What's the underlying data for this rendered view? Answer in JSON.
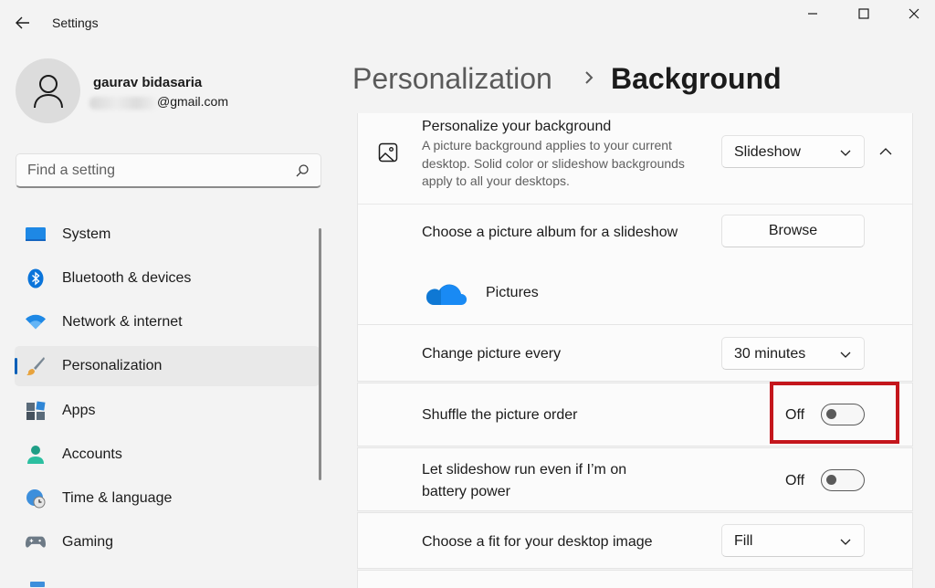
{
  "window": {
    "title": "Settings",
    "back_icon": "arrow-left-icon",
    "minimize_icon": "minimize-icon",
    "maximize_icon": "maximize-icon",
    "close_icon": "close-icon"
  },
  "profile": {
    "name": "gaurav bidasaria",
    "email_visible": "@gmail.com",
    "avatar_icon": "person-icon"
  },
  "search": {
    "placeholder": "Find a setting",
    "icon": "search-icon"
  },
  "nav": {
    "items": [
      {
        "label": "System",
        "icon": "monitor-icon",
        "active": false
      },
      {
        "label": "Bluetooth & devices",
        "icon": "bluetooth-icon",
        "active": false
      },
      {
        "label": "Network & internet",
        "icon": "wifi-icon",
        "active": false
      },
      {
        "label": "Personalization",
        "icon": "paintbrush-icon",
        "active": true
      },
      {
        "label": "Apps",
        "icon": "apps-icon",
        "active": false
      },
      {
        "label": "Accounts",
        "icon": "account-icon",
        "active": false
      },
      {
        "label": "Time & language",
        "icon": "globe-clock-icon",
        "active": false
      },
      {
        "label": "Gaming",
        "icon": "gamepad-icon",
        "active": false
      }
    ]
  },
  "header": {
    "parent": "Personalization",
    "separator": "›",
    "current": "Background"
  },
  "settings": {
    "personalize": {
      "title": "Personalize your background",
      "description": "A picture background applies to your current desktop. Solid color or slideshow backgrounds apply to all your desktops.",
      "value": "Slideshow",
      "icon": "image-icon",
      "collapse_icon": "chevron-up-icon"
    },
    "album": {
      "title": "Choose a picture album for a slideshow",
      "button": "Browse",
      "folder_label": "Pictures",
      "folder_icon": "onedrive-cloud-icon"
    },
    "interval": {
      "title": "Change picture every",
      "value": "30 minutes"
    },
    "shuffle": {
      "title": "Shuffle the picture order",
      "state": "Off"
    },
    "battery": {
      "title_line1": "Let slideshow run even if I’m on",
      "title_line2": "battery power",
      "state": "Off"
    },
    "fit": {
      "title": "Choose a fit for your desktop image",
      "value": "Fill"
    }
  },
  "colors": {
    "accent": "#005fb8",
    "highlight": "#c4161c"
  }
}
